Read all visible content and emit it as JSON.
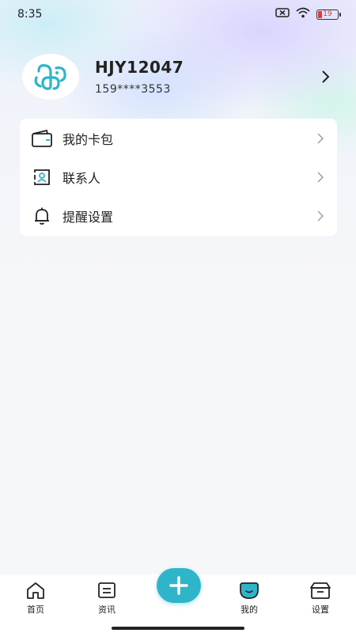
{
  "status_bar": {
    "time": "8:35",
    "battery": "19",
    "icons": [
      "sim-disabled-icon",
      "wifi-icon",
      "battery-icon"
    ]
  },
  "profile": {
    "username": "HJY12047",
    "phone": "159****3553"
  },
  "menu": {
    "items": [
      {
        "label": "我的卡包",
        "icon": "wallet-icon"
      },
      {
        "label": "联系人",
        "icon": "contact-icon"
      },
      {
        "label": "提醒设置",
        "icon": "bell-icon"
      }
    ]
  },
  "tabs": [
    {
      "label": "首页",
      "icon": "home-icon"
    },
    {
      "label": "资讯",
      "icon": "news-icon"
    },
    {
      "label": "我的",
      "icon": "profile-face-icon"
    },
    {
      "label": "设置",
      "icon": "settings-box-icon"
    }
  ],
  "colors": {
    "accent": "#2fb5c9",
    "battery_low": "#e53935"
  }
}
